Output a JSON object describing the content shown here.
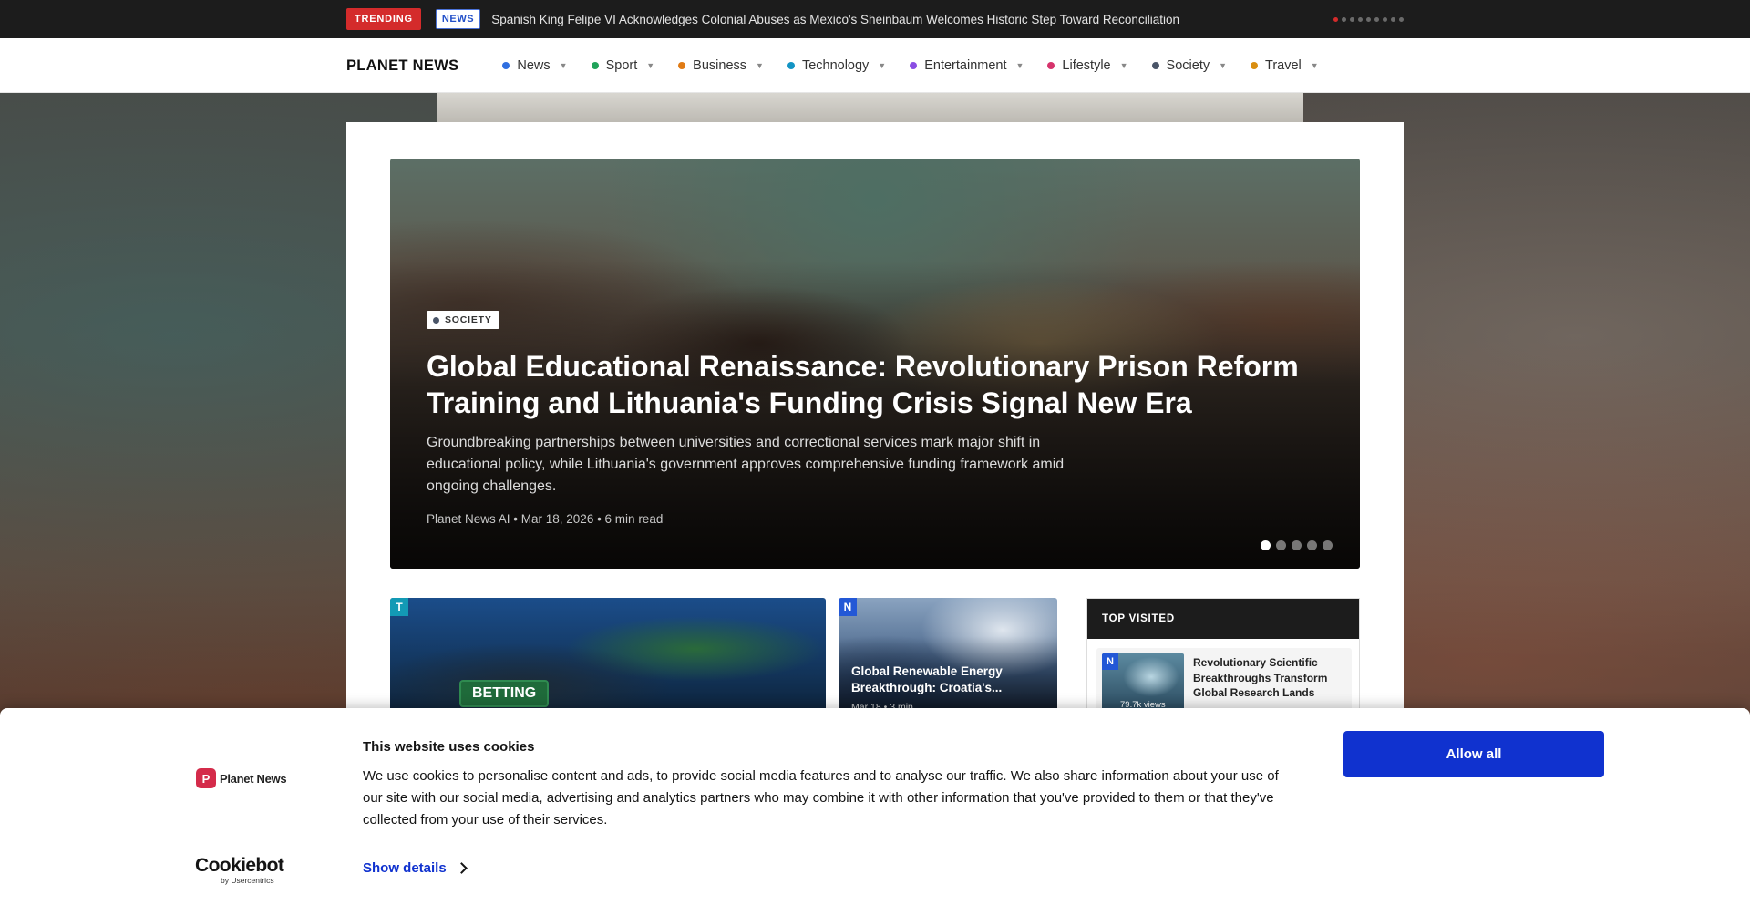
{
  "ticker": {
    "trending_label": "TRENDING",
    "category_badge": "NEWS",
    "headline": "Spanish King Felipe VI Acknowledges Colonial Abuses as Mexico's Sheinbaum Welcomes Historic Step Toward Reconciliation",
    "slides_total": 9,
    "active_slide": 1
  },
  "nav": {
    "logo": "PLANET NEWS",
    "items": [
      {
        "label": "News",
        "color": "#2f6fe0"
      },
      {
        "label": "Sport",
        "color": "#21a35a"
      },
      {
        "label": "Business",
        "color": "#e07b15"
      },
      {
        "label": "Technology",
        "color": "#1394c4"
      },
      {
        "label": "Entertainment",
        "color": "#8a4de3"
      },
      {
        "label": "Lifestyle",
        "color": "#d6336c"
      },
      {
        "label": "Society",
        "color": "#4a5568"
      },
      {
        "label": "Travel",
        "color": "#d98e10"
      }
    ],
    "caret": "▼"
  },
  "hero": {
    "category": "SOCIETY",
    "title": "Global Educational Renaissance: Revolutionary Prison Reform Training and Lithuania's Funding Crisis Signal New Era",
    "description": "Groundbreaking partnerships between universities and correctional services mark major shift in educational policy, while Lithuania's government approves comprehensive funding framework amid ongoing challenges.",
    "meta": "Planet News AI • Mar 18, 2026 • 6 min read",
    "slides_total": 5,
    "active_slide": 1
  },
  "cards": [
    {
      "letter": "T",
      "sign_text": "BETTING"
    },
    {
      "letter": "N",
      "title": "Global Renewable Energy Breakthrough: Croatia's...",
      "meta": "Mar 18 • 3 min"
    }
  ],
  "top_visited": {
    "header": "TOP VISITED",
    "items": [
      {
        "letter": "N",
        "views": "79.7k views",
        "title": "Revolutionary Scientific Breakthroughs Transform Global Research Lands"
      }
    ]
  },
  "cookie_banner": {
    "brand_mark": "P",
    "brand_name": "Planet News",
    "title": "This website uses cookies",
    "text": "We use cookies to personalise content and ads, to provide social media features and to analyse our traffic. We also share information about your use of our site with our social media, advertising and analytics partners who may combine it with other information that you've provided to them or that they've collected from your use of their services.",
    "details_label": "Show details",
    "allow_label": "Allow all",
    "provider_name": "Cookiebot",
    "provider_sub": "by Usercentrics"
  }
}
